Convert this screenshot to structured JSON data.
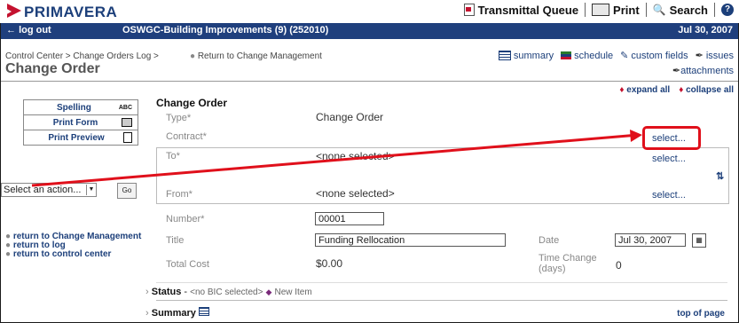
{
  "brand": {
    "name": "PRIMAVERA"
  },
  "topnav": {
    "transmittal": "Transmittal Queue",
    "print": "Print",
    "search": "Search",
    "help": "?"
  },
  "bar": {
    "logout": "log out",
    "project": "OSWGC-Building Improvements (9) (252010)",
    "date": "Jul 30, 2007"
  },
  "header": {
    "breadcrumb": "Control Center > Change Orders Log >",
    "return_mgmt": "Return to Change Management",
    "title": "Change Order"
  },
  "toolbar": {
    "summary": "summary",
    "schedule": "schedule",
    "custom_fields": "custom fields",
    "issues": "issues",
    "attachments": "attachments"
  },
  "expand": {
    "expand_all": "expand all",
    "collapse_all": "collapse all"
  },
  "left_panel": {
    "spelling": "Spelling",
    "spelling_icon": "ABC",
    "print_form": "Print Form",
    "print_preview": "Print Preview",
    "action_select": "Select an action...",
    "go": "Go",
    "links": [
      "return to Change Management",
      "return to log",
      "return to control center"
    ]
  },
  "form": {
    "section_title": "Change Order",
    "type_label": "Type*",
    "type_value": "Change Order",
    "contract_label": "Contract*",
    "select_link": "select...",
    "to_label": "To*",
    "to_value": "<none selected>",
    "from_label": "From*",
    "from_value": "<none selected>",
    "number_label": "Number*",
    "number_value": "00001",
    "title_label": "Title",
    "title_value": "Funding Rellocation",
    "date_label": "Date",
    "date_value": "Jul 30, 2007",
    "total_cost_label": "Total Cost",
    "total_cost_value": "$0.00",
    "time_change_label_1": "Time Change",
    "time_change_label_2": "(days)",
    "time_change_value": "0"
  },
  "status": {
    "label": "Status",
    "dash": " - ",
    "bic": "<no BIC selected>",
    "new_item": "New Item"
  },
  "summary": {
    "label": "Summary",
    "top_of_page": "top of page"
  },
  "colors": {
    "brand_red": "#c4122f",
    "nav_blue": "#1f3f7d",
    "highlight": "#e0101b"
  }
}
